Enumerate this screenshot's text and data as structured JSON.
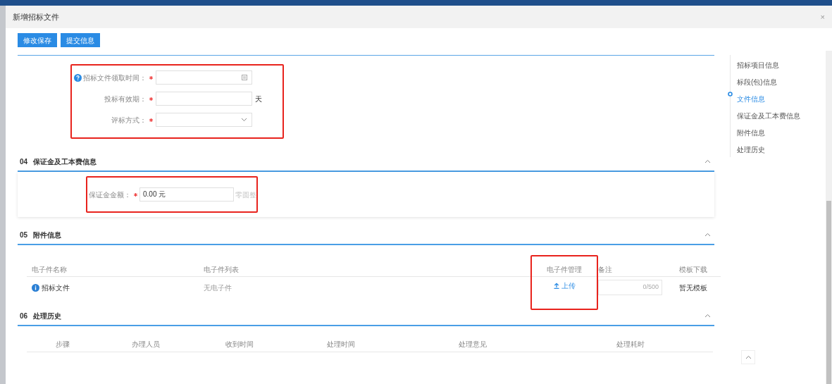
{
  "dialog": {
    "title": "新增招标文件",
    "close": "×"
  },
  "toolbar": {
    "buttons": [
      "修改保存",
      "提交信息"
    ]
  },
  "file_fields": {
    "highlighted": true,
    "fields": [
      {
        "kind": "date",
        "label": "招标文件领取时间：",
        "required": true,
        "help": true
      },
      {
        "kind": "text",
        "label": "投标有效期：",
        "required": true,
        "suffix": "天"
      },
      {
        "kind": "select",
        "label": "评标方式：",
        "required": true
      }
    ]
  },
  "sections": [
    {
      "kind": "form",
      "number": "04",
      "title": "保证金及工本费信息",
      "expanded": true,
      "highlighted": true,
      "field": {
        "label": "保证金金额：",
        "required": true,
        "value": "0.00 元",
        "hint": "零圆整"
      }
    },
    {
      "kind": "attachments",
      "number": "05",
      "title": "附件信息",
      "expanded": true,
      "columns": [
        {
          "label": "电子件名称",
          "highlighted": false
        },
        {
          "label": "电子件列表",
          "highlighted": false
        },
        {
          "label": "电子件管理",
          "highlighted": true
        },
        {
          "label": "备注",
          "highlighted": false
        },
        {
          "label": "模板下载",
          "highlighted": false
        }
      ],
      "rows": [
        {
          "name": "招标文件",
          "files": "无电子件",
          "action": "上传",
          "remark_count": "0/500",
          "template": "暂无模板"
        }
      ]
    },
    {
      "kind": "history",
      "number": "06",
      "title": "处理历史",
      "expanded": true,
      "columns": [
        "步骤",
        "办理人员",
        "收到时间",
        "处理时间",
        "处理意见",
        "处理耗时"
      ]
    }
  ],
  "nav": [
    {
      "label": "招标项目信息",
      "selected": false
    },
    {
      "label": "标段(包)信息",
      "selected": false
    },
    {
      "label": "文件信息",
      "selected": true
    },
    {
      "label": "保证金及工本费信息",
      "selected": false
    },
    {
      "label": "附件信息",
      "selected": false
    },
    {
      "label": "处理历史",
      "selected": false
    }
  ]
}
